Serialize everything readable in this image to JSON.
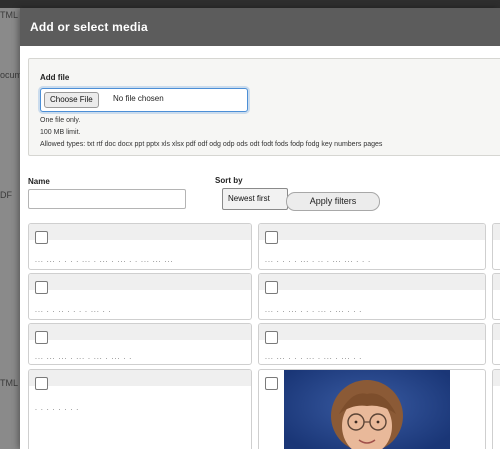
{
  "background": {
    "fragments": [
      "TML",
      "ocum",
      "DF",
      "TML"
    ]
  },
  "modal": {
    "title": "Add or select media"
  },
  "add_file": {
    "label": "Add file",
    "choose_button": "Choose File",
    "no_file_text": "No file chosen",
    "help_lines": [
      "One file only.",
      "100 MB limit.",
      "Allowed types: txt rtf doc docx ppt pptx xls xlsx pdf odf odg odp ods odt fodt fods fodp fodg key numbers pages"
    ]
  },
  "filters": {
    "name_label": "Name",
    "name_value": "",
    "sort_label": "Sort by",
    "sort_value": "Newest first",
    "apply_button": "Apply filters"
  },
  "media_items": [
    {
      "name": "...  ...  . . . . ... . ... . ...  . . ... ... ...",
      "has_thumbnail": false
    },
    {
      "name": "... . . . . ... . .. . ... ... . . .",
      "has_thumbnail": false
    },
    {
      "name": "",
      "has_thumbnail": false
    },
    {
      "name": "... . . .. . . . . ... . .",
      "has_thumbnail": false
    },
    {
      "name": "... . . ... . . . ... . ... . . .",
      "has_thumbnail": false
    },
    {
      "name": "",
      "has_thumbnail": false
    },
    {
      "name": "... ... ... . ... . ... . ... . .",
      "has_thumbnail": false
    },
    {
      "name": "... ... . . . ... . ... . ... . .",
      "has_thumbnail": false
    },
    {
      "name": "",
      "has_thumbnail": false
    },
    {
      "name": ". . . . . . . .",
      "has_thumbnail": false
    },
    {
      "name": "",
      "has_thumbnail": true
    },
    {
      "name": "",
      "has_thumbnail": false
    }
  ],
  "colors": {
    "header_bg": "#5c5c5c",
    "focus_blue": "#4c8fd6",
    "photo_background_blue": "#1f3f86"
  }
}
